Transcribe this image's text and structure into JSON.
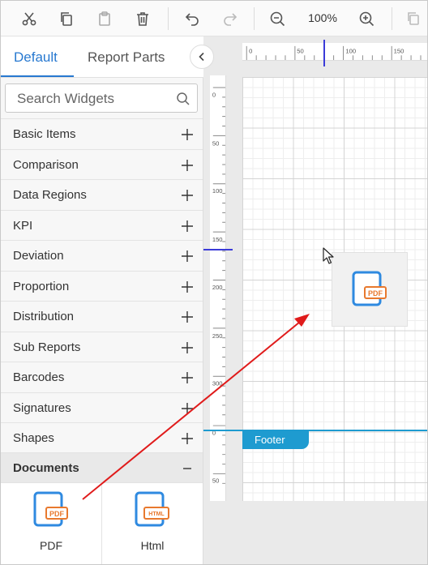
{
  "toolbar": {
    "zoom": "100%",
    "icons": [
      "cut-icon",
      "copy-icon",
      "paste-icon",
      "delete-icon",
      "undo-icon",
      "redo-icon",
      "zoom-out-icon",
      "zoom-in-icon",
      "copy-dropdown-icon"
    ]
  },
  "panel": {
    "tabs": [
      {
        "label": "Default",
        "active": true
      },
      {
        "label": "Report Parts",
        "active": false
      }
    ],
    "search_placeholder": "Search Widgets",
    "categories": [
      {
        "label": "Basic Items"
      },
      {
        "label": "Comparison"
      },
      {
        "label": "Data Regions"
      },
      {
        "label": "KPI"
      },
      {
        "label": "Deviation"
      },
      {
        "label": "Proportion"
      },
      {
        "label": "Distribution"
      },
      {
        "label": "Sub Reports"
      },
      {
        "label": "Barcodes"
      },
      {
        "label": "Signatures"
      },
      {
        "label": "Shapes"
      },
      {
        "label": "Documents",
        "expanded": true
      }
    ],
    "widgets": [
      {
        "label": "PDF",
        "badge": "PDF"
      },
      {
        "label": "Html",
        "badge": "HTML"
      }
    ]
  },
  "design": {
    "hruler_labels": [
      "0",
      "50",
      "100",
      "150"
    ],
    "vruler_labels": [
      "0",
      "50",
      "100",
      "150",
      "200",
      "250",
      "300"
    ],
    "footer_label": "Footer",
    "footer_ruler_labels": [
      "0",
      "50"
    ],
    "ghost_badge": "PDF"
  },
  "colors": {
    "accent": "#2879d0",
    "footer": "#1e9bd0",
    "icon_blue": "#2f8ae0",
    "icon_orange": "#e8792e",
    "arrow": "#e01b1b",
    "marker": "#3b3bd8"
  }
}
